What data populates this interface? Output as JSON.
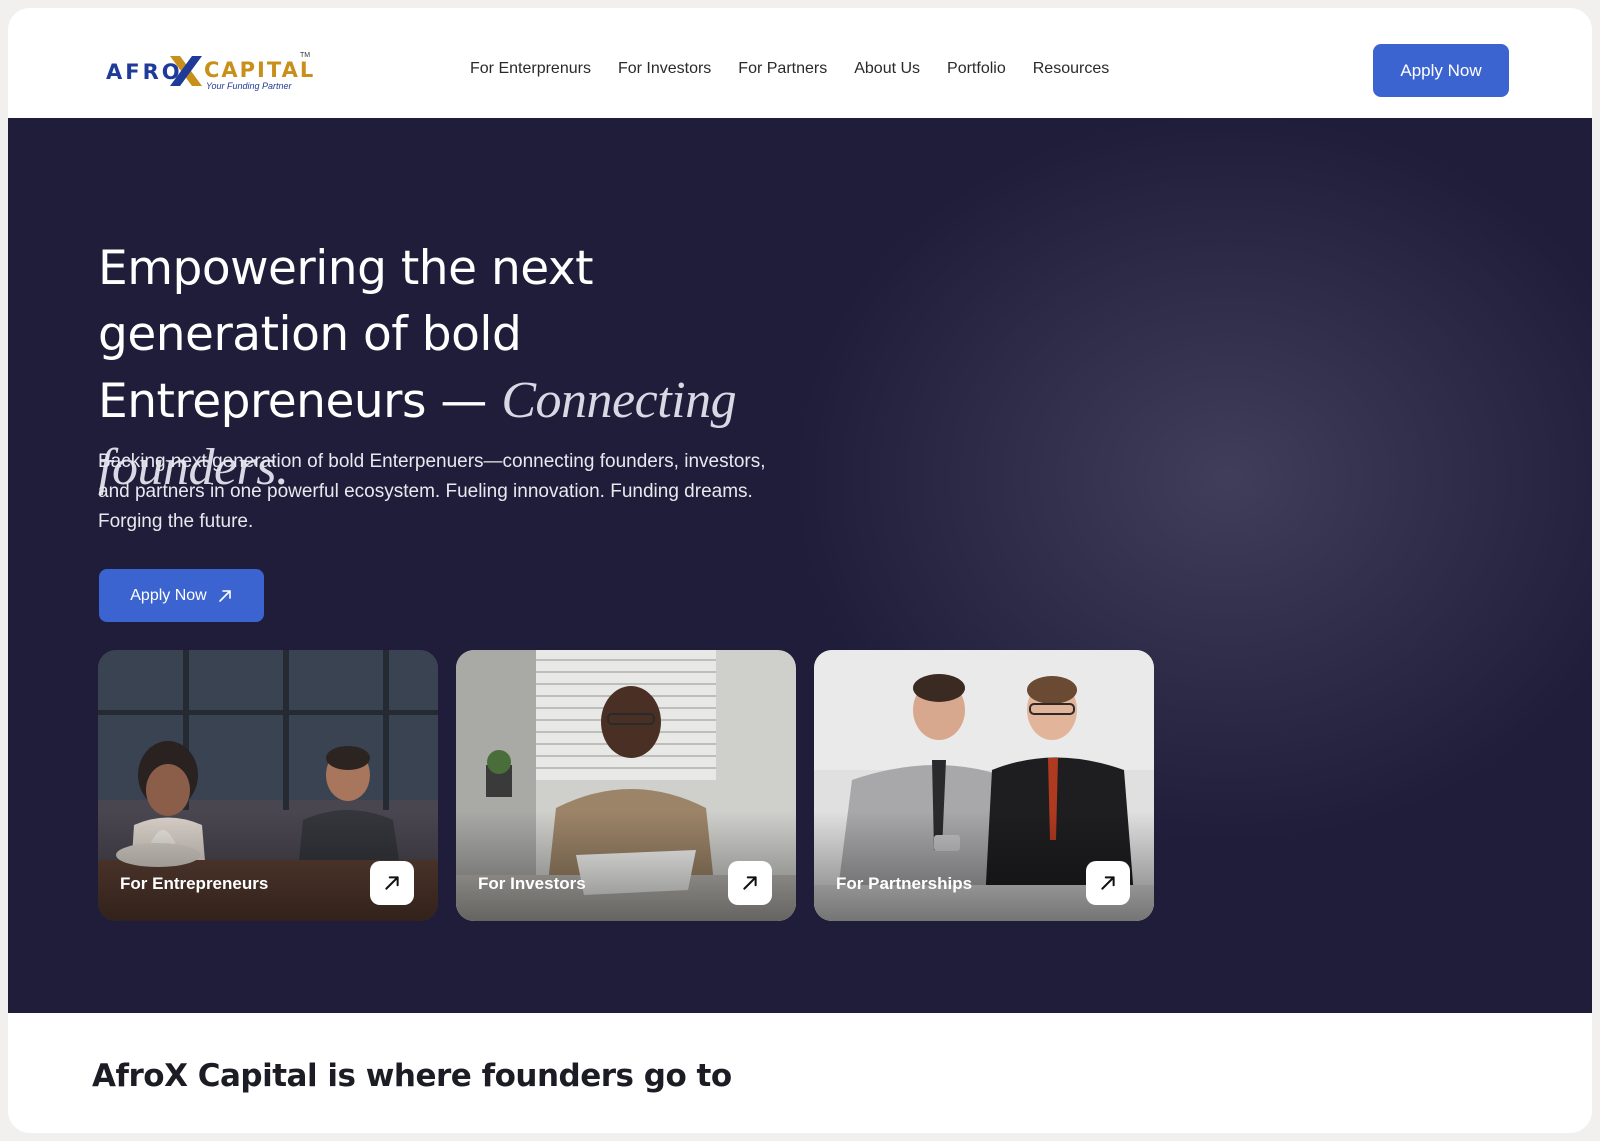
{
  "brand": {
    "logo_afro": "AFRO",
    "logo_capital": "CAPITAL",
    "logo_tm": "TM",
    "logo_tagline": "Your Funding Partner",
    "primary_color": "#3c64d0",
    "hero_bg": "#1f1d3a",
    "logo_blue": "#1f3b9a",
    "logo_gold": "#c8901a"
  },
  "nav": {
    "items": [
      {
        "label": "For Enterprenurs"
      },
      {
        "label": "For Investors"
      },
      {
        "label": "For Partners"
      },
      {
        "label": "About Us"
      },
      {
        "label": "Portfolio"
      },
      {
        "label": "Resources"
      }
    ],
    "cta_label": "Apply Now"
  },
  "hero": {
    "title_line": "Empowering the next generation of bold Entrepreneurs —",
    "title_accent": "Connecting founders.",
    "subtitle": "Backing next generation of bold Enterpenuers—connecting founders, investors, and partners in one powerful ecosystem. Fueling innovation. Funding dreams. Forging the future.",
    "cta_label": "Apply Now",
    "cta_icon": "arrow-up-right-icon"
  },
  "cards": [
    {
      "label": "For Entrepreneurs",
      "icon": "arrow-up-right-icon"
    },
    {
      "label": "For Investors",
      "icon": "arrow-up-right-icon"
    },
    {
      "label": "For Partnerships",
      "icon": "arrow-up-right-icon"
    }
  ],
  "lower": {
    "title": "AfroX Capital is where founders go to"
  }
}
